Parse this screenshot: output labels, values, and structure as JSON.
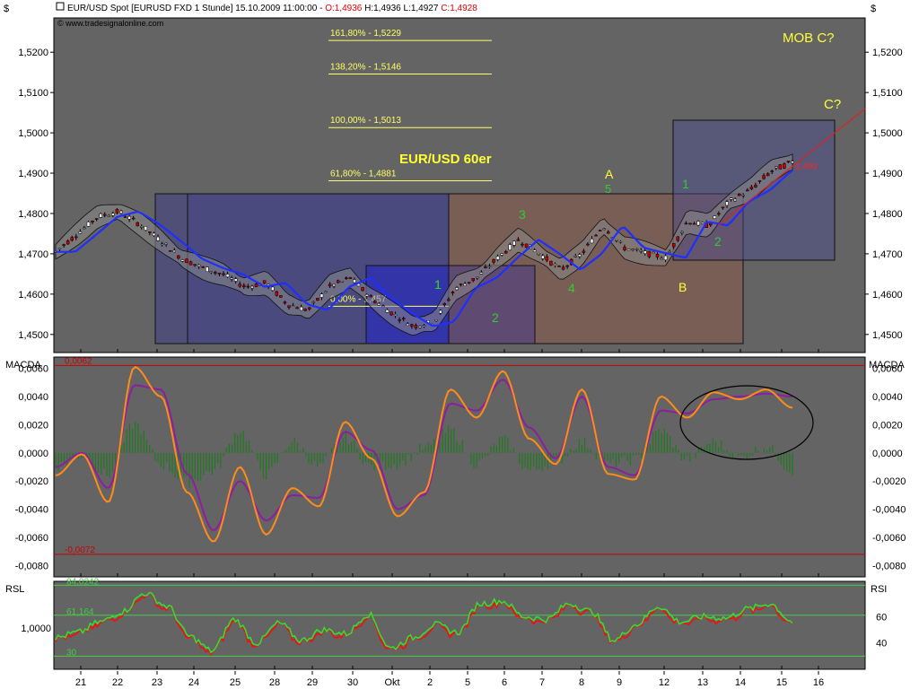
{
  "header": {
    "dollar_left": "$",
    "dollar_right": "$",
    "title_prefix": "EUR/USD Spot [EURUSD FXD  1 Stunde] 15.10.2009 11:00:00 - ",
    "open": "O:1,4936",
    "high_low": " H:1,4936 L:1,4927 ",
    "close": "C:1,4928",
    "source": "© www.tradesignalonline.com"
  },
  "colors": {
    "panel_bg": "#646464",
    "price_line": "#1f2fff",
    "fib": "#ffff66",
    "wave_green": "#33cc33",
    "wave_yellow": "#ffff33",
    "macd": "#ff8c1a",
    "signal": "#8b1fa0",
    "histogram": "#1f7a1f",
    "rsi_green": "#33dd33",
    "rsi_red": "#ee1111",
    "limit_red": "#cc0000"
  },
  "chart_data": [
    {
      "type": "candlestick",
      "title": "EUR/USD 60er",
      "ylim": [
        1.4455,
        1.5285
      ],
      "y_ticks": [
        "1,5200",
        "1,5100",
        "1,5000",
        "1,4900",
        "1,4800",
        "1,4700",
        "1,4600",
        "1,4500"
      ],
      "x_ticks": [
        "21",
        "22",
        "23",
        "24",
        "25",
        "28",
        "29",
        "30",
        "Okt",
        "2",
        "5",
        "6",
        "7",
        "8",
        "9",
        "12",
        "13",
        "14",
        "15",
        "16"
      ],
      "overlay": "moving average (blue) with Bollinger Bands",
      "fib_levels": [
        {
          "label": "161,80% - 1,5229",
          "value": 1.5229
        },
        {
          "label": "138,20% - 1,5146",
          "value": 1.5146
        },
        {
          "label": "100,00% - 1,5013",
          "value": 1.5013
        },
        {
          "label": "61,80% - 1,4881",
          "value": 1.4881
        },
        {
          "label": "0,00% - 1,457",
          "value": 1.457
        }
      ],
      "close_path": [
        {
          "day": "21",
          "close": 1.4705
        },
        {
          "day": "22",
          "close": 1.4748
        },
        {
          "day": "22",
          "close": 1.4792
        },
        {
          "day": "23",
          "close": 1.4805
        },
        {
          "day": "23",
          "close": 1.4773
        },
        {
          "day": "24",
          "close": 1.4732
        },
        {
          "day": "24",
          "close": 1.4688
        },
        {
          "day": "25",
          "close": 1.4665
        },
        {
          "day": "25",
          "close": 1.4648
        },
        {
          "day": "28",
          "close": 1.4618
        },
        {
          "day": "28",
          "close": 1.4628
        },
        {
          "day": "29",
          "close": 1.4575
        },
        {
          "day": "29",
          "close": 1.456
        },
        {
          "day": "30",
          "close": 1.4618
        },
        {
          "day": "30",
          "close": 1.464
        },
        {
          "day": "Okt",
          "close": 1.459
        },
        {
          "day": "Okt",
          "close": 1.4552
        },
        {
          "day": "2",
          "close": 1.452
        },
        {
          "day": "2",
          "close": 1.4532
        },
        {
          "day": "5",
          "close": 1.4615
        },
        {
          "day": "5",
          "close": 1.464
        },
        {
          "day": "6",
          "close": 1.469
        },
        {
          "day": "6",
          "close": 1.4735
        },
        {
          "day": "7",
          "close": 1.47
        },
        {
          "day": "7",
          "close": 1.466
        },
        {
          "day": "8",
          "close": 1.47
        },
        {
          "day": "8",
          "close": 1.477
        },
        {
          "day": "9",
          "close": 1.4715
        },
        {
          "day": "9",
          "close": 1.4702
        },
        {
          "day": "12",
          "close": 1.469
        },
        {
          "day": "12",
          "close": 1.478
        },
        {
          "day": "13",
          "close": 1.477
        },
        {
          "day": "13",
          "close": 1.483
        },
        {
          "day": "14",
          "close": 1.4858
        },
        {
          "day": "14",
          "close": 1.4905
        },
        {
          "day": "15",
          "close": 1.4928
        }
      ],
      "last_price_label": "1,492",
      "annotations": [
        "A",
        "5",
        "1",
        "3",
        "4",
        "B",
        "1",
        "2",
        "1",
        "2",
        "MOB C?",
        "C?"
      ]
    },
    {
      "type": "line",
      "title": "MACDA",
      "ylim": [
        -0.0088,
        0.0068
      ],
      "y_ticks": [
        "0,0060",
        "0,0040",
        "0,0020",
        "0,0000",
        "-0,0020",
        "-0,0040",
        "-0,0060",
        "-0,0080"
      ],
      "limits": [
        {
          "label": "0,0062",
          "value": 0.0062
        },
        {
          "label": "-0,0072",
          "value": -0.0072
        }
      ],
      "series": [
        {
          "name": "",
          "values": [
            -0.0016,
            -0.0001,
            -0.0035,
            0.0061,
            0.004,
            -0.0028,
            -0.0063,
            -0.001,
            -0.0058,
            -0.0025,
            -0.0038,
            0.0022,
            -0.0004,
            -0.0045,
            -0.0028,
            0.0045,
            0.0025,
            0.0058,
            0.001,
            -0.0008,
            0.0045,
            -0.0015,
            -0.0019,
            0.004,
            0.0025,
            0.0043,
            0.0038,
            0.0045,
            0.0032
          ]
        },
        {
          "name": "",
          "values": [
            -0.001,
            0.0,
            -0.0025,
            0.0048,
            0.0045,
            -0.0015,
            -0.0055,
            -0.002,
            -0.0048,
            -0.003,
            -0.0032,
            0.0015,
            0.0002,
            -0.004,
            -0.003,
            0.0035,
            0.003,
            0.0052,
            0.0018,
            -0.0004,
            0.004,
            -0.001,
            -0.0016,
            0.003,
            0.0028,
            0.0038,
            0.004,
            0.0042,
            0.004
          ]
        }
      ]
    },
    {
      "type": "line",
      "title": "RSL",
      "right_title": "RSI",
      "ylim": [
        20,
        87
      ],
      "y_ticks_right": [
        "60",
        "40"
      ],
      "left_tick": "1,0000",
      "levels": [
        {
          "label": "84,0242",
          "value": 84.0242
        },
        {
          "label": "61,164",
          "value": 61.164
        },
        {
          "label": "30",
          "value": 30
        }
      ],
      "series": [
        {
          "name": "",
          "values": [
            44,
            48,
            56,
            64,
            78,
            68,
            45,
            34,
            58,
            40,
            55,
            42,
            50,
            47,
            62,
            36,
            44,
            54,
            48,
            70,
            72,
            60,
            58,
            70,
            64,
            42,
            54,
            68,
            56,
            60,
            59,
            66,
            70,
            56
          ]
        }
      ]
    }
  ]
}
